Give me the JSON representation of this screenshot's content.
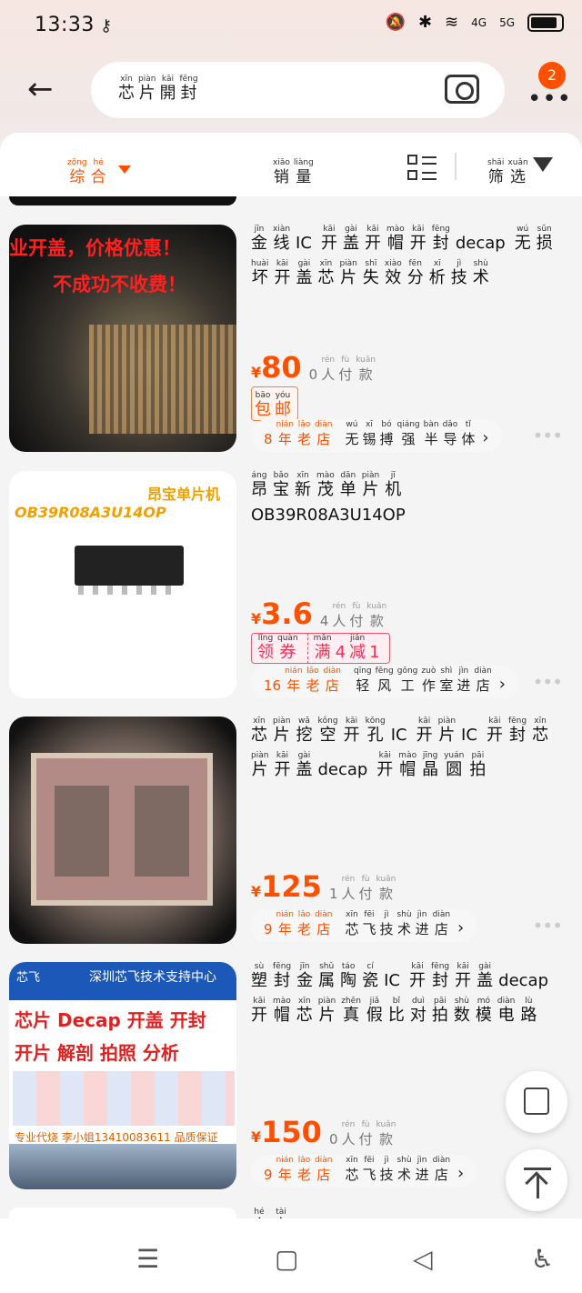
{
  "status_bar": {
    "time": "13:33",
    "key_glyph": "⚷",
    "net4g": "4G",
    "net5g": "5G"
  },
  "search": {
    "query": [
      {
        "py": "xīn",
        "hz": "芯"
      },
      {
        "py": "piàn",
        "hz": "片"
      },
      {
        "py": "kāi",
        "hz": "開"
      },
      {
        "py": "fēng",
        "hz": "封"
      }
    ],
    "badge": "2"
  },
  "sort": {
    "zonghe": [
      {
        "py": "zōng",
        "hz": "综"
      },
      {
        "py": "hé",
        "hz": "合"
      }
    ],
    "xiaoliang": [
      {
        "py": "xiāo",
        "hz": "销"
      },
      {
        "py": "liàng",
        "hz": "量"
      }
    ],
    "shaixuan": [
      {
        "py": "shāi",
        "hz": "筛"
      },
      {
        "py": "xuǎn",
        "hz": "选"
      }
    ],
    "active_color": "#ff5000"
  },
  "products": [
    {
      "title": [
        {
          "py": "jīn",
          "hz": "金"
        },
        {
          "py": "xiàn",
          "hz": "线"
        },
        {
          "latin": "IC"
        },
        {
          "py": "kāi",
          "hz": "开"
        },
        {
          "py": "gài",
          "hz": "盖"
        },
        {
          "py": "kāi",
          "hz": "开"
        },
        {
          "py": "mào",
          "hz": "帽"
        },
        {
          "py": "kāi",
          "hz": "开"
        },
        {
          "py": "fēng",
          "hz": "封"
        },
        {
          "latin": "decap"
        },
        {
          "py": "wú",
          "hz": "无"
        },
        {
          "py": "sǔn",
          "hz": "损"
        },
        {
          "py": "huài",
          "hz": "坏"
        },
        {
          "py": "kāi",
          "hz": "开"
        },
        {
          "py": "gài",
          "hz": "盖"
        },
        {
          "py": "xīn",
          "hz": "芯"
        },
        {
          "py": "piàn",
          "hz": "片"
        },
        {
          "py": "shī",
          "hz": "失"
        },
        {
          "py": "xiào",
          "hz": "效"
        },
        {
          "py": "fēn",
          "hz": "分"
        },
        {
          "py": "xī",
          "hz": "析"
        },
        {
          "py": "jì",
          "hz": "技"
        },
        {
          "py": "shù",
          "hz": "术"
        }
      ],
      "price_symbol": "¥",
      "price": "80",
      "sales_num": "0",
      "sales": [
        {
          "py": "rén",
          "hz": "人"
        },
        {
          "py": "fù",
          "hz": "付"
        },
        {
          "py": "kuǎn",
          "hz": "款"
        }
      ],
      "tag": [
        {
          "py": "bāo",
          "hz": "包"
        },
        {
          "py": "yóu",
          "hz": "邮"
        }
      ],
      "shop_years": [
        {
          "py": "",
          "hz": "8"
        },
        {
          "py": "nián",
          "hz": "年"
        },
        {
          "py": "lǎo",
          "hz": "老"
        },
        {
          "py": "diàn",
          "hz": "店"
        }
      ],
      "shop_name": [
        {
          "py": "wú",
          "hz": "无"
        },
        {
          "py": "xī",
          "hz": "锡"
        },
        {
          "py": "bó",
          "hz": "搏"
        },
        {
          "py": "qiáng",
          "hz": "强"
        },
        {
          "py": "bàn",
          "hz": "半"
        },
        {
          "py": "dǎo",
          "hz": "导"
        },
        {
          "py": "tǐ",
          "hz": "体"
        }
      ],
      "thumb_text1": "业开盖，价格优惠！",
      "thumb_text2": "不成功不收费！"
    },
    {
      "title": [
        {
          "py": "áng",
          "hz": "昂"
        },
        {
          "py": "bǎo",
          "hz": "宝"
        },
        {
          "py": "xīn",
          "hz": "新"
        },
        {
          "py": "mào",
          "hz": "茂"
        },
        {
          "py": "dān",
          "hz": "单"
        },
        {
          "py": "piàn",
          "hz": "片"
        },
        {
          "py": "jī",
          "hz": "机"
        },
        {
          "latin": "OB39R08A3U14OP"
        }
      ],
      "price_symbol": "¥",
      "price": "3.6",
      "sales_num": "4",
      "sales": [
        {
          "py": "rén",
          "hz": "人"
        },
        {
          "py": "fù",
          "hz": "付"
        },
        {
          "py": "kuǎn",
          "hz": "款"
        }
      ],
      "coupon_left": [
        {
          "py": "lǐng",
          "hz": "领"
        },
        {
          "py": "quàn",
          "hz": "券"
        }
      ],
      "coupon_right": [
        {
          "py": "mǎn",
          "hz": "满"
        },
        {
          "py": "",
          "hz": "4"
        },
        {
          "py": "jiǎn",
          "hz": "减"
        },
        {
          "py": "",
          "hz": "1"
        }
      ],
      "shop_years": [
        {
          "py": "",
          "hz": "16"
        },
        {
          "py": "nián",
          "hz": "年"
        },
        {
          "py": "lǎo",
          "hz": "老"
        },
        {
          "py": "diàn",
          "hz": "店"
        }
      ],
      "shop_name": [
        {
          "py": "qīng",
          "hz": "轻"
        },
        {
          "py": "fēng",
          "hz": "风"
        },
        {
          "py": "gōng",
          "hz": "工"
        },
        {
          "py": "zuò",
          "hz": "作"
        },
        {
          "py": "shì",
          "hz": "室"
        },
        {
          "py": "jìn",
          "hz": "进"
        },
        {
          "py": "diàn",
          "hz": "店"
        }
      ],
      "thumb_text1": "昂宝单片机",
      "thumb_text2": "OB39R08A3U14OP"
    },
    {
      "title": [
        {
          "py": "xīn",
          "hz": "芯"
        },
        {
          "py": "piàn",
          "hz": "片"
        },
        {
          "py": "wā",
          "hz": "挖"
        },
        {
          "py": "kōng",
          "hz": "空"
        },
        {
          "py": "kāi",
          "hz": "开"
        },
        {
          "py": "kǒng",
          "hz": "孔"
        },
        {
          "latin": "IC"
        },
        {
          "py": "kāi",
          "hz": "开"
        },
        {
          "py": "piàn",
          "hz": "片"
        },
        {
          "latin": "IC"
        },
        {
          "py": "kāi",
          "hz": "开"
        },
        {
          "py": "fēng",
          "hz": "封"
        },
        {
          "py": "xīn",
          "hz": "芯"
        },
        {
          "py": "piàn",
          "hz": "片"
        },
        {
          "py": "kāi",
          "hz": "开"
        },
        {
          "py": "gài",
          "hz": "盖"
        },
        {
          "latin": "decap"
        },
        {
          "py": "kāi",
          "hz": "开"
        },
        {
          "py": "mào",
          "hz": "帽"
        },
        {
          "py": "jīng",
          "hz": "晶"
        },
        {
          "py": "yuán",
          "hz": "圆"
        },
        {
          "py": "pāi",
          "hz": "拍"
        }
      ],
      "price_symbol": "¥",
      "price": "125",
      "sales_num": "1",
      "sales": [
        {
          "py": "rén",
          "hz": "人"
        },
        {
          "py": "fù",
          "hz": "付"
        },
        {
          "py": "kuǎn",
          "hz": "款"
        }
      ],
      "shop_years": [
        {
          "py": "",
          "hz": "9"
        },
        {
          "py": "nián",
          "hz": "年"
        },
        {
          "py": "lǎo",
          "hz": "老"
        },
        {
          "py": "diàn",
          "hz": "店"
        }
      ],
      "shop_name": [
        {
          "py": "xīn",
          "hz": "芯"
        },
        {
          "py": "fēi",
          "hz": "飞"
        },
        {
          "py": "jì",
          "hz": "技"
        },
        {
          "py": "shù",
          "hz": "术"
        },
        {
          "py": "jìn",
          "hz": "进"
        },
        {
          "py": "diàn",
          "hz": "店"
        }
      ]
    },
    {
      "title": [
        {
          "py": "sù",
          "hz": "塑"
        },
        {
          "py": "fēng",
          "hz": "封"
        },
        {
          "py": "jīn",
          "hz": "金"
        },
        {
          "py": "shǔ",
          "hz": "属"
        },
        {
          "py": "táo",
          "hz": "陶"
        },
        {
          "py": "cí",
          "hz": "瓷"
        },
        {
          "latin": "IC"
        },
        {
          "py": "kāi",
          "hz": "开"
        },
        {
          "py": "fēng",
          "hz": "封"
        },
        {
          "py": "kāi",
          "hz": "开"
        },
        {
          "py": "gài",
          "hz": "盖"
        },
        {
          "latin": "decap"
        },
        {
          "py": "kāi",
          "hz": "开"
        },
        {
          "py": "mào",
          "hz": "帽"
        },
        {
          "py": "xīn",
          "hz": "芯"
        },
        {
          "py": "piàn",
          "hz": "片"
        },
        {
          "py": "zhēn",
          "hz": "真"
        },
        {
          "py": "jiǎ",
          "hz": "假"
        },
        {
          "py": "bǐ",
          "hz": "比"
        },
        {
          "py": "duì",
          "hz": "对"
        },
        {
          "py": "pāi",
          "hz": "拍"
        },
        {
          "py": "shù",
          "hz": "数"
        },
        {
          "py": "mó",
          "hz": "模"
        },
        {
          "py": "diàn",
          "hz": "电"
        },
        {
          "py": "lù",
          "hz": "路"
        }
      ],
      "price_symbol": "¥",
      "price": "150",
      "sales_num": "0",
      "sales": [
        {
          "py": "rén",
          "hz": "人"
        },
        {
          "py": "fù",
          "hz": "付"
        },
        {
          "py": "kuǎn",
          "hz": "款"
        }
      ],
      "shop_years": [
        {
          "py": "",
          "hz": "9"
        },
        {
          "py": "nián",
          "hz": "年"
        },
        {
          "py": "lǎo",
          "hz": "老"
        },
        {
          "py": "diàn",
          "hz": "店"
        }
      ],
      "shop_name": [
        {
          "py": "xīn",
          "hz": "芯"
        },
        {
          "py": "fēi",
          "hz": "飞"
        },
        {
          "py": "jì",
          "hz": "技"
        },
        {
          "py": "shù",
          "hz": "术"
        },
        {
          "py": "jìn",
          "hz": "进"
        },
        {
          "py": "diàn",
          "hz": "店"
        }
      ],
      "thumb_head": "深圳芯飞技术支持中心",
      "thumb_logo": "芯飞",
      "thumb_r1": "芯片 Decap  开盖  开封",
      "thumb_r2": "开片  解剖  拍照  分析",
      "thumb_foot": "专业代烧  李小姐13410083611  品质保证"
    }
  ],
  "partial_next": [
    {
      "py": "hé",
      "hz": "合"
    },
    {
      "py": "tài",
      "hz": "泰"
    }
  ],
  "nav": {
    "menu": "☰",
    "home": "▢",
    "back": "◁",
    "access": "♿"
  },
  "colors": {
    "accent": "#ff5000",
    "background": "#f4f4f4"
  }
}
